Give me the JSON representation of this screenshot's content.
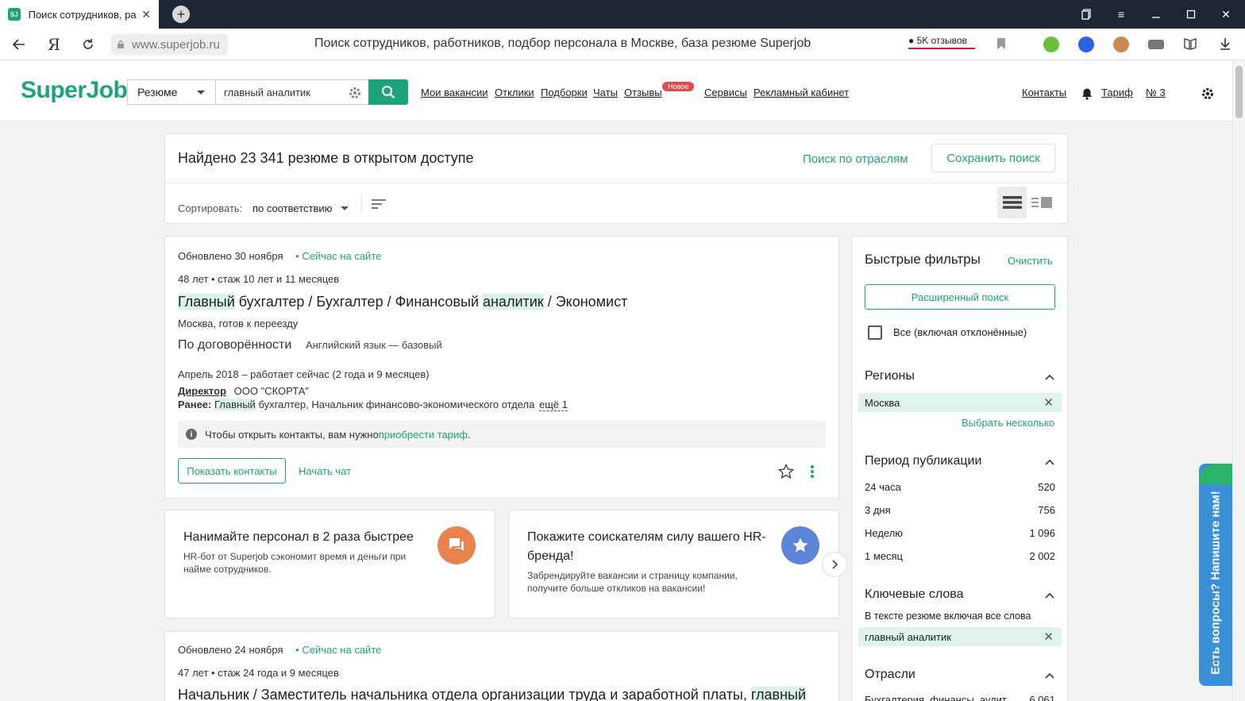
{
  "browser": {
    "tab_title": "Поиск сотрудников, ра",
    "favicon_text": "SJ",
    "url": "www.superjob.ru",
    "page_title": "Поиск сотрудников, работников, подбор персонала в Москве, база резюме Superjob",
    "reviews_pill": "5K отзывов"
  },
  "header": {
    "logo": "SuperJob",
    "search_type": "Резюме",
    "search_query": "главный аналитик",
    "nav": [
      "Мои вакансии",
      "Отклики",
      "Подборки",
      "Чаты",
      "Отзывы",
      "Сервисы",
      "Рекламный кабинет"
    ],
    "new_badge": "Новое",
    "right_nav": [
      "Контакты",
      "Тариф",
      "№ 3"
    ]
  },
  "results": {
    "title": "Найдено 23 341 резюме в открытом доступе",
    "industry_search": "Поиск по отраслям",
    "save_search": "Сохранить поиск",
    "sort_label": "Сортировать:",
    "sort_value": "по соответствию"
  },
  "resume1": {
    "updated": "Обновлено 30 ноября",
    "online": "Сейчас на сайте",
    "age_exp": "48 лет • стаж 10 лет и 11 месяцев",
    "title_parts": [
      "Главный",
      " бухгалтер / Бухгалтер / Финансовый ",
      "аналитик",
      " / Экономист"
    ],
    "location": "Москва, готов к переезду",
    "salary": "По договорённости",
    "language": "Английский язык — базовый",
    "period": "Апрель 2018 – работает сейчас (2 года и 9 месяцев)",
    "position": "Директор",
    "company": "ООО \"СКОРТА\"",
    "earlier_label": "Ранее:",
    "earlier_hl": "Главный",
    "earlier_rest": " бухгалтер, Начальник финансово-экономического отдела",
    "more": "ещё 1",
    "contacts_note": "Чтобы открыть контакты, вам нужно ",
    "contacts_link": "приобрести тариф",
    "contacts_note_end": ".",
    "show_contacts": "Показать контакты",
    "start_chat": "Начать чат"
  },
  "promos": [
    {
      "title": "Нанимайте персонал в 2 раза быстрее",
      "text": "HR-бот от Superjob сэкономит время и деньги при найме сотрудников.",
      "color": "#e8834f"
    },
    {
      "title": "Покажите соискателям силу вашего HR-бренда!",
      "text": "Забрендируйте вакансии и страницу компании, получите больше откликов на вакансии!",
      "color": "#5c84d8"
    }
  ],
  "resume2": {
    "updated": "Обновлено 24 ноября",
    "online": "Сейчас на сайте",
    "age_exp": "47 лет • стаж 24 года и 9 месяцев",
    "title": "Начальник / Заместитель начальника отдела организации труда и заработной платы, ",
    "title_hl": "главный"
  },
  "filters": {
    "title": "Быстрые фильтры",
    "clear": "Очистить",
    "advanced": "Расширенный поиск",
    "all_checkbox": "Все (включая отклонённые)",
    "regions_title": "Регионы",
    "region_chip": "Москва",
    "choose_several": "Выбрать несколько",
    "period_title": "Период публикации",
    "periods": [
      {
        "label": "24 часа",
        "count": "520"
      },
      {
        "label": "3 дня",
        "count": "756"
      },
      {
        "label": "Неделю",
        "count": "1 096"
      },
      {
        "label": "1 месяц",
        "count": "2 002"
      }
    ],
    "keywords_title": "Ключевые слова",
    "keywords_mode": "В тексте резюме включая все слова",
    "keyword_chip": "главный аналитик",
    "industries_title": "Отрасли",
    "industry_first": "Бухгалтерия, финансы, аудит",
    "industry_first_count": "6 061"
  },
  "feedback": "Есть вопросы? Напишите нам!",
  "colors": {
    "brand": "#1fa37a",
    "highlight": "#d8f3ea",
    "badge": "#e04a4a"
  }
}
